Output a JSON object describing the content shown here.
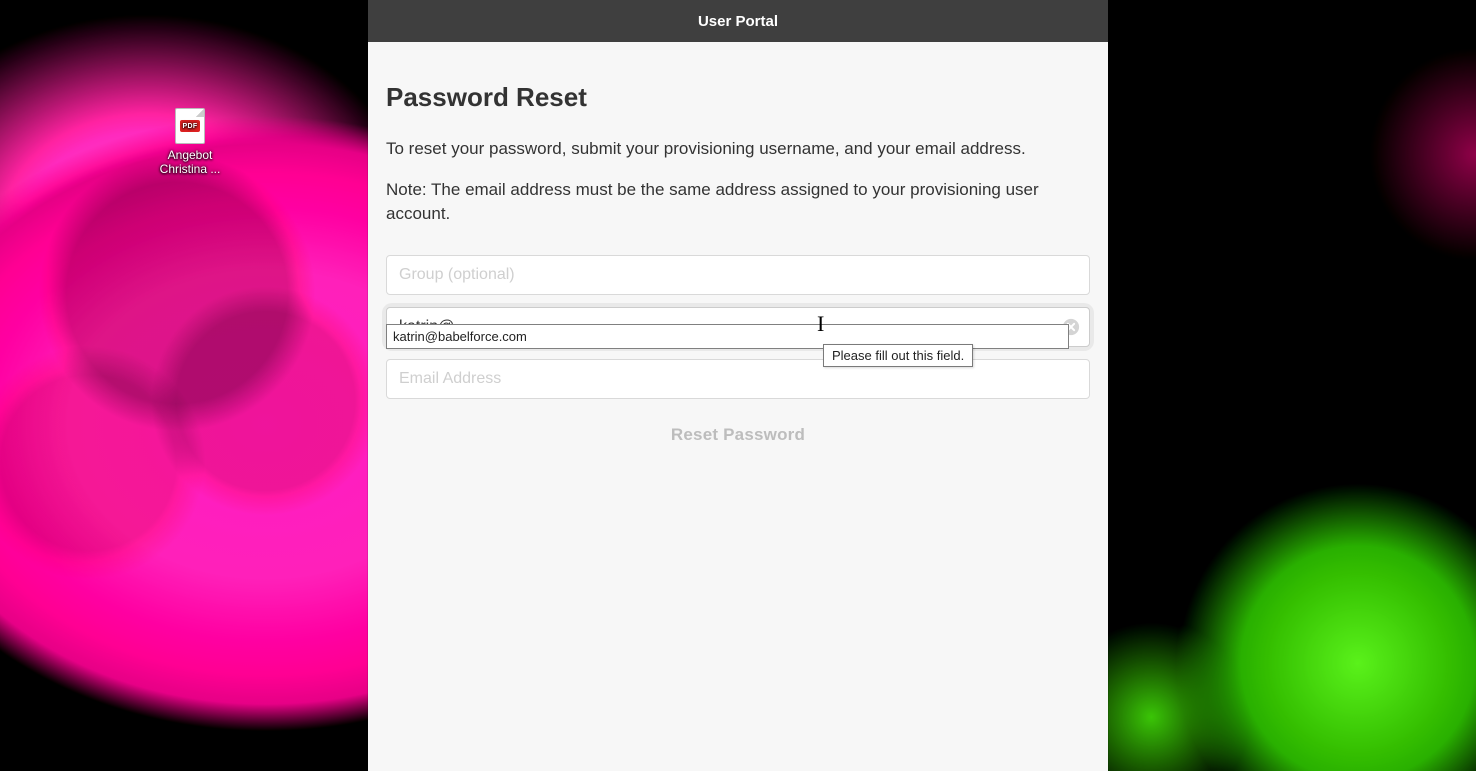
{
  "desktop": {
    "icon": {
      "badge": "PDF",
      "label": "Angebot Christina ..."
    }
  },
  "portal": {
    "title": "User Portal",
    "heading": "Password Reset",
    "intro": "To reset your password, submit your provisioning username, and your email address.",
    "note": "Note: The email address must be the same address assigned to your provisioning user account.",
    "fields": {
      "group": {
        "placeholder": "Group (optional)",
        "value": ""
      },
      "username": {
        "placeholder": "",
        "value": "katrin@"
      },
      "email": {
        "placeholder": "Email Address",
        "value": ""
      }
    },
    "autocomplete": {
      "items": [
        "katrin@babelforce.com"
      ]
    },
    "tooltip": "Please fill out this field.",
    "reset_label": "Reset Password"
  }
}
